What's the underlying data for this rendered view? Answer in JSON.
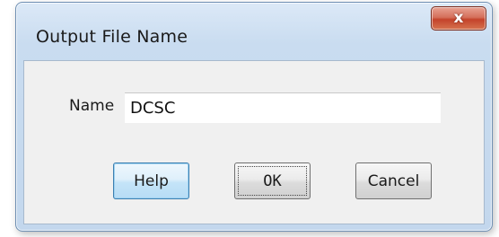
{
  "dialog": {
    "title": "Output File Name",
    "close_symbol": "x",
    "close_icon": "close-icon"
  },
  "form": {
    "name_label": "Name",
    "name_value": "DCSC"
  },
  "buttons": {
    "help_label": "Help",
    "ok_label": "OK",
    "cancel_label": "Cancel"
  },
  "colors": {
    "close_button": "#c4432b",
    "title_bar": "#c9dcf0",
    "client_area": "#f0f0f0",
    "focused_button_border": "#3c7fb1"
  }
}
